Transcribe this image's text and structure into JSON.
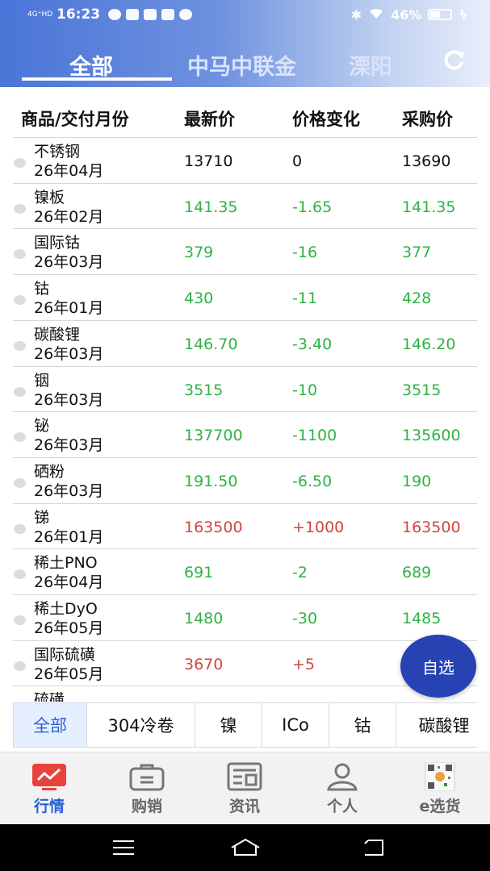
{
  "status_bar": {
    "signal": "4G⁺HD",
    "time": "16:23",
    "battery": "46%",
    "battery_level": 0.46
  },
  "top_tabs": [
    {
      "label": "全部",
      "active": true
    },
    {
      "label": "中马中联金",
      "active": false
    },
    {
      "label": "溧阳",
      "active": false
    }
  ],
  "table": {
    "headers": [
      "商品/交付月份",
      "最新价",
      "价格变化",
      "采购价"
    ],
    "rows": [
      {
        "name": "不锈钢",
        "month": "26年04月",
        "latest": "13710",
        "change": "0",
        "purchase": "13690",
        "color": "black"
      },
      {
        "name": "镍板",
        "month": "26年02月",
        "latest": "141.35",
        "change": "-1.65",
        "purchase": "141.35",
        "color": "green"
      },
      {
        "name": "国际钴",
        "month": "26年03月",
        "latest": "379",
        "change": "-16",
        "purchase": "377",
        "color": "green"
      },
      {
        "name": "钴",
        "month": "26年01月",
        "latest": "430",
        "change": "-11",
        "purchase": "428",
        "color": "green"
      },
      {
        "name": "碳酸锂",
        "month": "26年03月",
        "latest": "146.70",
        "change": "-3.40",
        "purchase": "146.20",
        "color": "green"
      },
      {
        "name": "铟",
        "month": "26年03月",
        "latest": "3515",
        "change": "-10",
        "purchase": "3515",
        "color": "green"
      },
      {
        "name": "铋",
        "month": "26年03月",
        "latest": "137700",
        "change": "-1100",
        "purchase": "135600",
        "color": "green"
      },
      {
        "name": "硒粉",
        "month": "26年03月",
        "latest": "191.50",
        "change": "-6.50",
        "purchase": "190",
        "color": "green"
      },
      {
        "name": "锑",
        "month": "26年01月",
        "latest": "163500",
        "change": "+1000",
        "purchase": "163500",
        "color": "red"
      },
      {
        "name": "稀土PNO",
        "month": "26年04月",
        "latest": "691",
        "change": "-2",
        "purchase": "689",
        "color": "green"
      },
      {
        "name": "稀土DyO",
        "month": "26年05月",
        "latest": "1480",
        "change": "-30",
        "purchase": "1485",
        "color": "green"
      },
      {
        "name": "国际硫磺",
        "month": "26年05月",
        "latest": "3670",
        "change": "+5",
        "purchase": "",
        "color": "red"
      },
      {
        "name": "硫磺",
        "month": "",
        "latest": "",
        "change": "",
        "purchase": "",
        "color": "black"
      }
    ]
  },
  "fab_label": "自选",
  "category_tabs": [
    {
      "label": "全部",
      "active": true
    },
    {
      "label": "304冷卷",
      "active": false
    },
    {
      "label": "镍",
      "active": false
    },
    {
      "label": "ICo",
      "active": false
    },
    {
      "label": "钴",
      "active": false
    },
    {
      "label": "碳酸锂",
      "active": false
    }
  ],
  "bottom_nav": [
    {
      "label": "行情",
      "icon": "market-chart-icon",
      "active": true
    },
    {
      "label": "购销",
      "icon": "briefcase-icon",
      "active": false
    },
    {
      "label": "资讯",
      "icon": "news-icon",
      "active": false
    },
    {
      "label": "个人",
      "icon": "person-icon",
      "active": false
    },
    {
      "label": "e选货",
      "icon": "qr-code-icon",
      "active": false
    }
  ],
  "colors": {
    "green": "#2fb344",
    "red": "#d2453f",
    "accent": "#2a62d8",
    "fab": "#2742b3"
  }
}
